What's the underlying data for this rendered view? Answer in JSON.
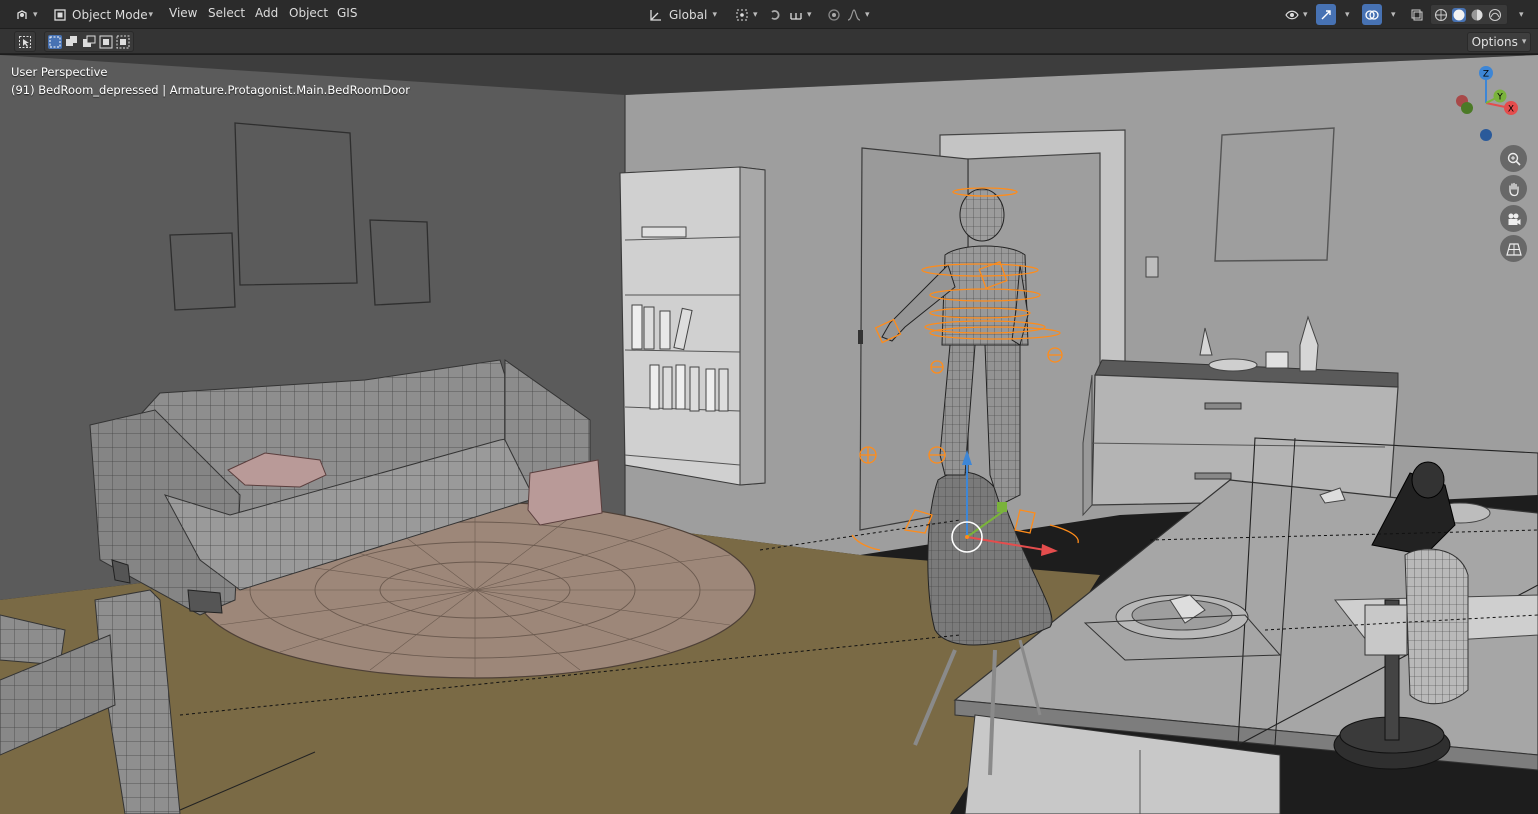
{
  "header": {
    "editor_type_icon": "3d-viewport-icon",
    "mode": {
      "icon": "object-mode-icon",
      "label": "Object Mode"
    },
    "menus": [
      "View",
      "Select",
      "Add",
      "Object",
      "GIS"
    ],
    "orientation": {
      "icon": "transform-orientation-icon",
      "label": "Global"
    },
    "pivot_icon": "pivot-point-icon",
    "snap_icon": "snap-icon",
    "snap_target_icon": "snap-increment-icon",
    "proportional_icon": "proportional-edit-icon",
    "falloff_icon": "falloff-curve-icon",
    "visibility_icon": "eye-icon",
    "gizmo_icon": "gizmo-icon",
    "overlay_icon": "overlay-icon",
    "xray_icon": "xray-icon",
    "shading_modes": [
      "wireframe",
      "solid",
      "material",
      "rendered"
    ],
    "active_shading": "solid"
  },
  "toolrow": {
    "tool_icon": "select-box-icon",
    "select_modes": [
      "set",
      "extend",
      "subtract",
      "intersect"
    ],
    "options_label": "Options"
  },
  "viewport": {
    "view_name": "User Perspective",
    "object_info": "(91) BedRoom_depressed | Armature.Protagonist.Main.BedRoomDoor"
  },
  "gizmo": {
    "axes": [
      "X",
      "Y",
      "Z"
    ],
    "colors": {
      "x": "#e44d4d",
      "y": "#7ab33b",
      "z": "#3d86d6"
    }
  },
  "nav_tools": [
    "zoom-icon",
    "pan-hand-icon",
    "camera-view-icon",
    "ortho-grid-icon"
  ],
  "colors": {
    "header_bg": "#2b2b2b",
    "accent": "#4772b3",
    "floor": "#7a6a45",
    "wall_left": "#5c5c5c",
    "wall_back": "#9d9d9d",
    "armature": "#ff8c1a"
  }
}
